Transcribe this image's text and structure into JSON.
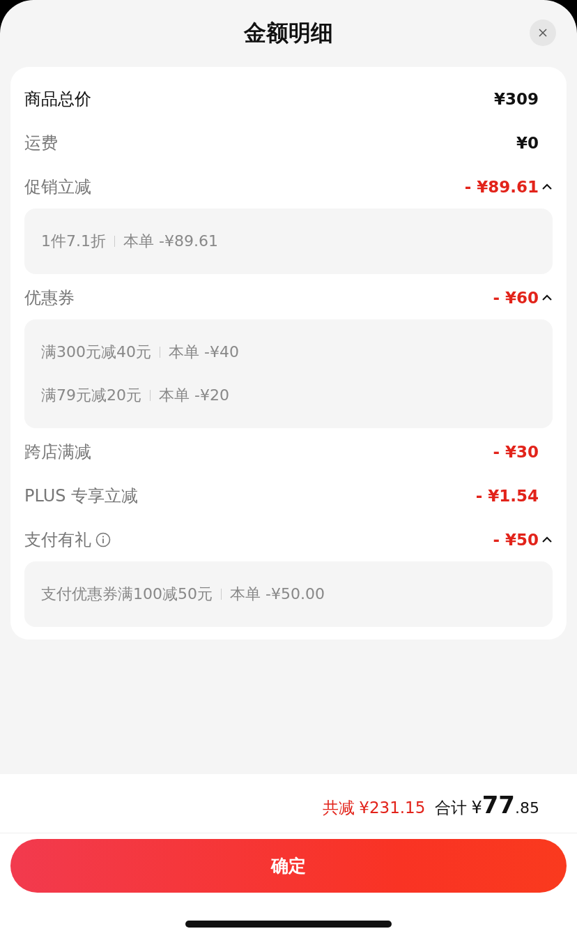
{
  "title": "金额明细",
  "rows": [
    {
      "kind": "total",
      "label": "商品总价",
      "amount": "¥309"
    },
    {
      "kind": "plain",
      "label": "运费",
      "amount": "¥0"
    },
    {
      "kind": "discount",
      "label": "促销立减",
      "amount": "- ¥89.61",
      "expanded": true,
      "details": [
        {
          "name": "1件7.1折",
          "value": "本单 -¥89.61"
        }
      ]
    },
    {
      "kind": "discount",
      "label": "优惠券",
      "amount": "- ¥60",
      "expanded": true,
      "details": [
        {
          "name": "满300元减40元",
          "value": "本单 -¥40"
        },
        {
          "name": "满79元减20元",
          "value": "本单 -¥20"
        }
      ]
    },
    {
      "kind": "discount",
      "label": "跨店满减",
      "amount": "- ¥30"
    },
    {
      "kind": "discount",
      "label": "PLUS 专享立减",
      "amount": "- ¥1.54"
    },
    {
      "kind": "discount",
      "label": "支付有礼",
      "info": true,
      "amount": "- ¥50",
      "expanded": true,
      "details": [
        {
          "name": "支付优惠券满100减50元",
          "value": "本单 -¥50.00"
        }
      ]
    }
  ],
  "summary": {
    "saved_label": "共减",
    "saved_amount": "¥231.15",
    "total_label": "合计",
    "total_currency": "¥",
    "total_integer": "77",
    "total_decimal": ".85"
  },
  "confirm_button": "确定"
}
